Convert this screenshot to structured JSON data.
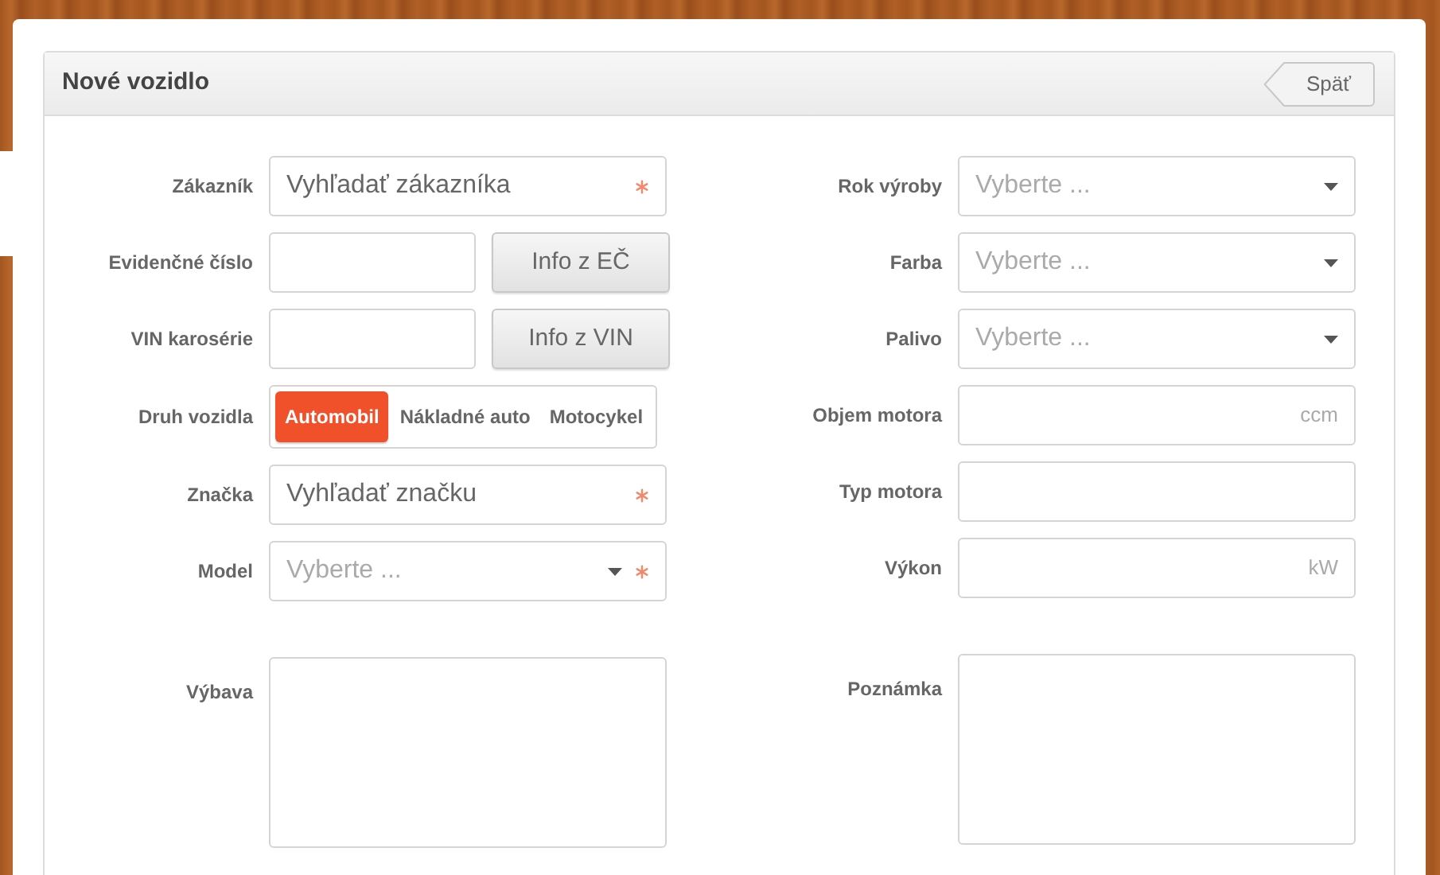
{
  "panel": {
    "title": "Nové vozidlo",
    "back_button": "Späť"
  },
  "left_fields": [
    {
      "kind": "search",
      "label": "Zákazník",
      "placeholder": "Vyhľadať zákazníka",
      "required": true
    },
    {
      "kind": "input_button",
      "label": "Evidenčné číslo",
      "button": "Info z EČ"
    },
    {
      "kind": "input_button",
      "label": "VIN karosérie",
      "button": "Info z VIN"
    },
    {
      "kind": "segmented",
      "label": "Druh vozidla",
      "options": [
        {
          "label": "Automobil",
          "selected": true
        },
        {
          "label": "Nákladné auto",
          "selected": false
        },
        {
          "label": "Motocykel",
          "selected": false
        }
      ]
    },
    {
      "kind": "search",
      "label": "Značka",
      "placeholder": "Vyhľadať značku",
      "required": true
    },
    {
      "kind": "select",
      "label": "Model",
      "placeholder": "Vyberte ...",
      "required": true
    },
    {
      "kind": "textarea",
      "label": "Výbava"
    }
  ],
  "right_fields": [
    {
      "kind": "select",
      "label": "Rok výroby",
      "placeholder": "Vyberte ...",
      "required": false
    },
    {
      "kind": "select",
      "label": "Farba",
      "placeholder": "Vyberte ...",
      "required": false
    },
    {
      "kind": "select",
      "label": "Palivo",
      "placeholder": "Vyberte ...",
      "required": false
    },
    {
      "kind": "unit",
      "label": "Objem motora",
      "unit": "ccm"
    },
    {
      "kind": "text",
      "label": "Typ motora"
    },
    {
      "kind": "unit",
      "label": "Výkon",
      "unit": "kW"
    },
    {
      "kind": "textarea",
      "label": "Poznámka"
    }
  ]
}
